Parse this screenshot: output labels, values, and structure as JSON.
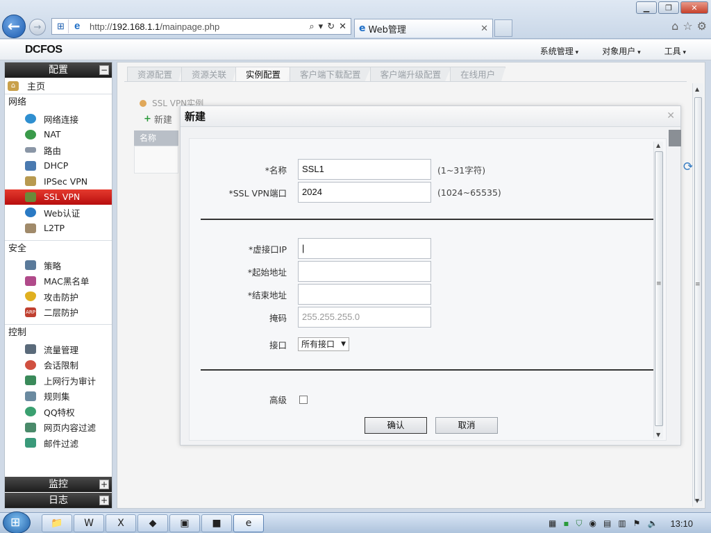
{
  "browser": {
    "url_prefix": "http://",
    "url_host": "192.168.1.1",
    "url_path": "/mainpage.php",
    "tab_title": "Web管理"
  },
  "app": {
    "logo": "DCFOS",
    "top_menu": [
      "系统管理",
      "对象用户",
      "工具"
    ]
  },
  "sidebar": {
    "title": "配置",
    "home": "主页",
    "groups": [
      {
        "label": "网络",
        "items": [
          "网络连接",
          "NAT",
          "路由",
          "DHCP",
          "IPSec VPN",
          "SSL VPN",
          "Web认证",
          "L2TP"
        ]
      },
      {
        "label": "安全",
        "items": [
          "策略",
          "MAC黑名单",
          "攻击防护",
          "二层防护"
        ]
      },
      {
        "label": "控制",
        "items": [
          "流量管理",
          "会话限制",
          "上网行为审计",
          "规则集",
          "QQ特权",
          "网页内容过滤",
          "邮件过滤"
        ]
      }
    ],
    "active_item": "SSL VPN",
    "bottom_sections": [
      "监控",
      "日志"
    ]
  },
  "main": {
    "subtabs": [
      "资源配置",
      "资源关联",
      "实例配置",
      "客户端下载配置",
      "客户端升级配置",
      "在线用户"
    ],
    "active_subtab": "实例配置",
    "section_title": "SSL VPN实例",
    "new_button": "新建",
    "grid_header": "名称"
  },
  "dialog": {
    "title": "新建",
    "fields": {
      "name": {
        "label": "*名称",
        "value": "SSL1",
        "hint": "(1~31字符)"
      },
      "port": {
        "label": "*SSL VPN端口",
        "value": "2024",
        "hint": "(1024~65535)"
      },
      "vip": {
        "label": "*虚接口IP",
        "value": ""
      },
      "start": {
        "label": "*起始地址",
        "value": ""
      },
      "end": {
        "label": "*结束地址",
        "value": ""
      },
      "mask": {
        "label": "掩码",
        "placeholder": "255.255.255.0"
      },
      "iface": {
        "label": "接口",
        "value": "所有接口"
      },
      "advanced": {
        "label": "高级",
        "checked": false
      }
    },
    "confirm": "确认",
    "cancel": "取消"
  },
  "taskbar": {
    "clock": "13:10"
  }
}
